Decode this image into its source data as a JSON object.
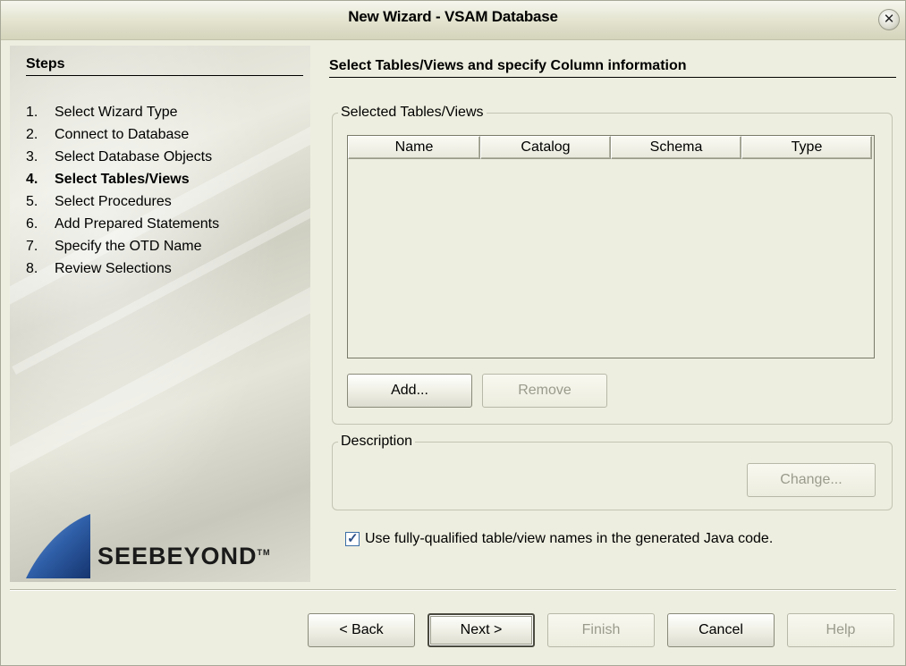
{
  "window": {
    "title": "New Wizard - VSAM Database",
    "close_icon": "close-icon"
  },
  "steps": {
    "heading": "Steps",
    "items": [
      {
        "num": "1.",
        "label": "Select Wizard Type"
      },
      {
        "num": "2.",
        "label": "Connect to Database"
      },
      {
        "num": "3.",
        "label": "Select Database Objects"
      },
      {
        "num": "4.",
        "label": "Select Tables/Views",
        "active": true
      },
      {
        "num": "5.",
        "label": "Select Procedures"
      },
      {
        "num": "6.",
        "label": "Add Prepared Statements"
      },
      {
        "num": "7.",
        "label": "Specify the OTD Name"
      },
      {
        "num": "8.",
        "label": "Review Selections"
      }
    ],
    "logo": "SEEBEYOND",
    "logo_tm": "TM"
  },
  "main": {
    "title": "Select Tables/Views and specify Column information",
    "tables_group": {
      "legend": "Selected Tables/Views",
      "columns": [
        "Name",
        "Catalog",
        "Schema",
        "Type"
      ],
      "rows": [],
      "add_label": "Add...",
      "remove_label": "Remove"
    },
    "description_group": {
      "legend": "Description",
      "change_label": "Change..."
    },
    "fully_qualified": {
      "label": "Use fully-qualified table/view names in the generated Java code.",
      "checked": true
    }
  },
  "footer": {
    "back_label": "< Back",
    "next_label": "Next >",
    "finish_label": "Finish",
    "cancel_label": "Cancel",
    "help_label": "Help"
  },
  "colors": {
    "background": "#eeeee0",
    "border": "#c4c4b4",
    "disabled_text": "#9a9a8c",
    "logo_blue": "#2f5fa8"
  }
}
